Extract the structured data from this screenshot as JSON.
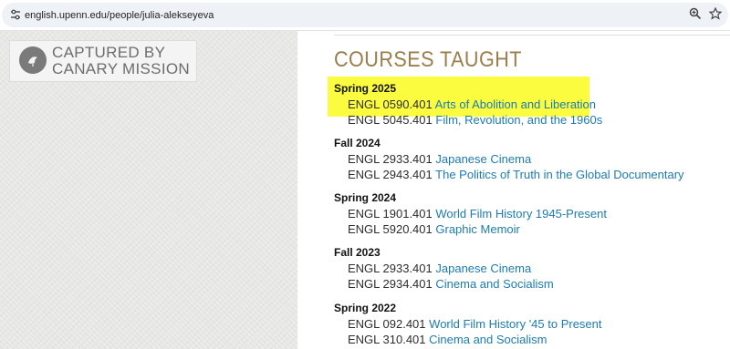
{
  "browser": {
    "url": "english.upenn.edu/people/julia-alekseyeva",
    "site_info_icon": "site-info-icon",
    "zoom_icon": "zoom-icon",
    "bookmark_icon": "star-icon"
  },
  "watermark": {
    "line1": "CAPTURED BY",
    "line2": "CANARY MISSION"
  },
  "page": {
    "heading": "COURSES TAUGHT",
    "terms": [
      {
        "label": "Spring 2025",
        "courses": [
          {
            "code": "ENGL 0590.401",
            "title": "Arts of Abolition and Liberation"
          },
          {
            "code": "ENGL 5045.401",
            "title": "Film, Revolution, and the 1960s"
          }
        ]
      },
      {
        "label": "Fall 2024",
        "courses": [
          {
            "code": "ENGL 2933.401",
            "title": "Japanese Cinema"
          },
          {
            "code": "ENGL 2943.401",
            "title": "The Politics of Truth in the Global Documentary"
          }
        ]
      },
      {
        "label": "Spring 2024",
        "courses": [
          {
            "code": "ENGL 1901.401",
            "title": "World Film History 1945-Present"
          },
          {
            "code": "ENGL 5920.401",
            "title": "Graphic Memoir"
          }
        ]
      },
      {
        "label": "Fall 2023",
        "courses": [
          {
            "code": "ENGL 2933.401",
            "title": "Japanese Cinema"
          },
          {
            "code": "ENGL 2934.401",
            "title": "Cinema and Socialism"
          }
        ]
      },
      {
        "label": "Spring 2022",
        "courses": [
          {
            "code": "ENGL 092.401",
            "title": "World Film History '45 to Present"
          },
          {
            "code": "ENGL 310.401",
            "title": "Cinema and Socialism"
          }
        ]
      }
    ]
  },
  "colors": {
    "heading": "#9b7e4c",
    "link": "#1d7bb0",
    "highlight": "#fbfb40"
  }
}
